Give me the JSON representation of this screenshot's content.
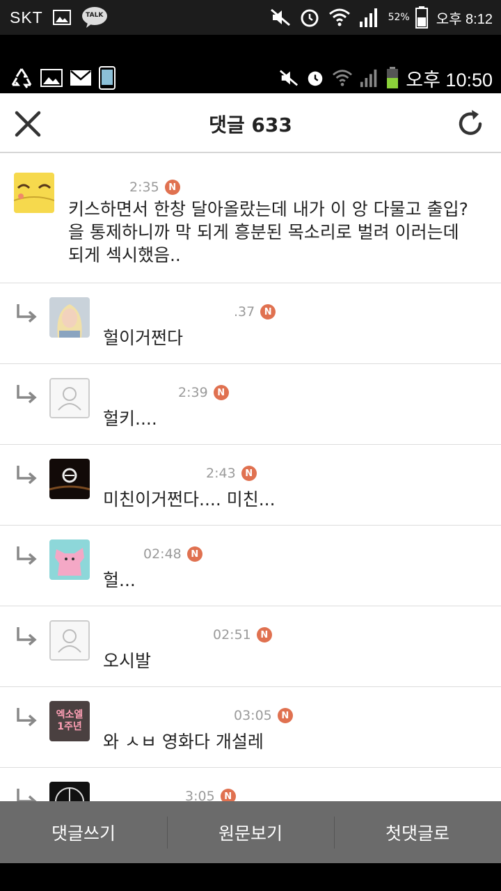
{
  "outer_status": {
    "carrier": "SKT",
    "talk": "TALK",
    "battery_pct": "52%",
    "time": "오후 8:12"
  },
  "inner_status": {
    "time": "오후 10:50"
  },
  "header": {
    "title": "댓글 633"
  },
  "comments": [
    {
      "time": "2:35",
      "badge": "N",
      "text": "키스하면서 한창 달아올랐는데 내가 이 앙 다물고 출입?을 통제하니까 막 되게 흥분된 목소리로 벌려 이러는데 되게 섹시했음..",
      "avatar": "yellow-cartoon"
    },
    {
      "time": ".37",
      "badge": "N",
      "text": "헐이거쩐다",
      "avatar": "blonde-person"
    },
    {
      "time": "2:39",
      "badge": "N",
      "text": "헐키....",
      "avatar": "default-person"
    },
    {
      "time": "2:43",
      "badge": "N",
      "text": "미친이거쩐다.... 미친...",
      "avatar": "dark-logo"
    },
    {
      "time": "02:48",
      "badge": "N",
      "text": "헐...",
      "avatar": "pink-character"
    },
    {
      "time": "02:51",
      "badge": "N",
      "text": "오시발",
      "avatar": "default-person"
    },
    {
      "time": "03:05",
      "badge": "N",
      "text": "와 ㅅㅂ 영화다 개설레",
      "avatar": "exo-anniversary",
      "avatar_text": "엑소엘 1주년"
    },
    {
      "time": "3:05",
      "badge": "N",
      "text": "",
      "avatar": "mercedes-logo"
    }
  ],
  "footer": {
    "write": "댓글쓰기",
    "original": "원문보기",
    "first": "첫댓글로"
  },
  "colors": {
    "bottom_bar": "#6b6b6b",
    "badge": "#e07150"
  }
}
